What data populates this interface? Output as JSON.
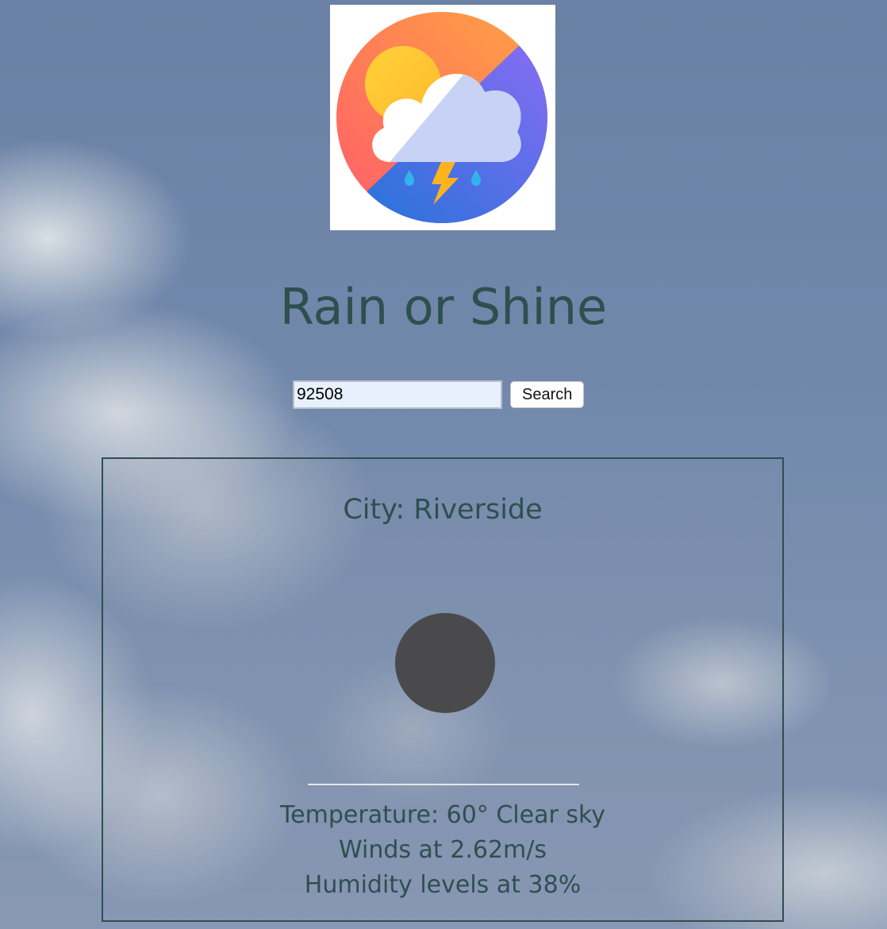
{
  "app": {
    "title": "Rain or Shine",
    "logo_icon": "weather-cloud-sun-storm-icon"
  },
  "search": {
    "value": "92508",
    "button_label": "Search"
  },
  "result": {
    "city": "City: Riverside",
    "condition_icon": "clear-sky-icon",
    "temperature": "Temperature: 60° Clear sky",
    "wind": "Winds at 2.62m/s",
    "humidity": "Humidity levels at 38%"
  },
  "colors": {
    "text": "#2f4f4f",
    "card_border": "#2f4f4f",
    "icon_fill": "#4a4a4d"
  }
}
